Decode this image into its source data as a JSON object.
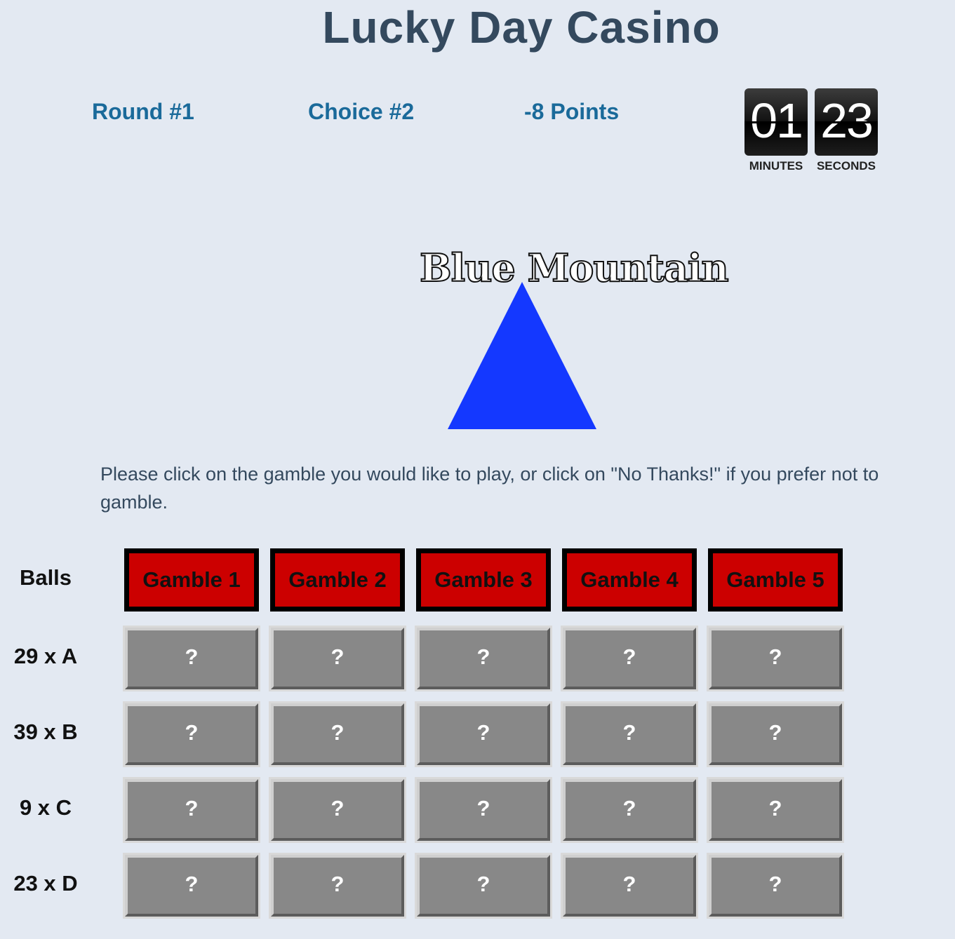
{
  "app_title": "Lucky Day Casino",
  "status": {
    "round": "Round #1",
    "choice": "Choice #2",
    "points": "-8 Points"
  },
  "timer": {
    "minutes_value": "01",
    "seconds_value": "23",
    "minutes_label": "MINUTES",
    "seconds_label": "SECONDS"
  },
  "logo": {
    "text": "Blue Mountain",
    "shape": "triangle",
    "shape_color": "#1438ff"
  },
  "instructions": "Please click on the gamble you would like to play, or click on \"No Thanks!\" if you prefer not to gamble.",
  "table": {
    "header_label": "Balls",
    "gambles": [
      "Gamble 1",
      "Gamble 2",
      "Gamble 3",
      "Gamble 4",
      "Gamble 5"
    ],
    "rows": [
      {
        "label": "29 x A",
        "cells": [
          "?",
          "?",
          "?",
          "?",
          "?"
        ]
      },
      {
        "label": "39 x B",
        "cells": [
          "?",
          "?",
          "?",
          "?",
          "?"
        ]
      },
      {
        "label": "9 x C",
        "cells": [
          "?",
          "?",
          "?",
          "?",
          "?"
        ]
      },
      {
        "label": "23 x D",
        "cells": [
          "?",
          "?",
          "?",
          "?",
          "?"
        ]
      }
    ]
  },
  "colors": {
    "background": "#e3e9f2",
    "title": "#34495e",
    "status": "#1a6a9a",
    "gamble_button": "#cc0000",
    "cell": "#888888"
  }
}
